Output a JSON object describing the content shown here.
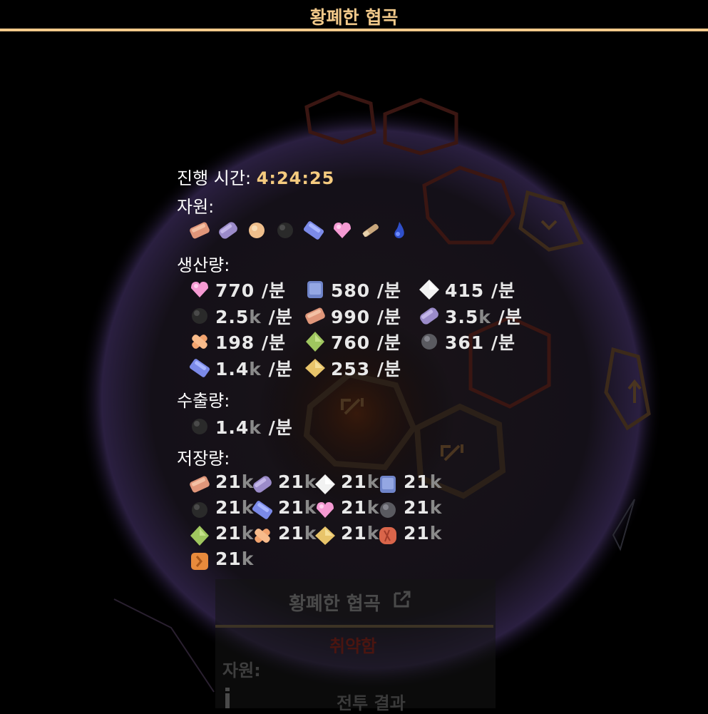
{
  "header": {
    "title": "황폐한 협곡"
  },
  "details": {
    "elapsed_label": "진행 시간:",
    "elapsed_value": "4:24:25",
    "resources_label": "자원:",
    "resources": [
      "copper-ore",
      "mythril-ore",
      "sand",
      "coal",
      "cobalt-ore",
      "heart-crystal",
      "wood",
      "water"
    ],
    "production_label": "생산량:",
    "production": [
      {
        "icon": "pink-heart",
        "amount": "770",
        "unit": " /분"
      },
      {
        "icon": "blue-block",
        "amount": "580",
        "unit": " /분"
      },
      {
        "icon": "white-diamond",
        "amount": "415",
        "unit": " /분"
      },
      {
        "icon": "coal",
        "amount": "2.5",
        "suffix": "k",
        "unit": " /분"
      },
      {
        "icon": "copper-ore",
        "amount": "990",
        "unit": " /분"
      },
      {
        "icon": "mythril-ore",
        "amount": "3.5",
        "suffix": "k",
        "unit": " /분"
      },
      {
        "icon": "orange-stripes",
        "amount": "198",
        "unit": " /분"
      },
      {
        "icon": "green-diamond",
        "amount": "760",
        "unit": " /분"
      },
      {
        "icon": "grey-stone",
        "amount": "361",
        "unit": " /분"
      },
      {
        "icon": "cobalt-ore",
        "amount": "1.4",
        "suffix": "k",
        "unit": " /분"
      },
      {
        "icon": "gold-diamond",
        "amount": "253",
        "unit": " /분"
      }
    ],
    "export_label": "수출량:",
    "export": [
      {
        "icon": "coal",
        "amount": "1.4",
        "suffix": "k",
        "unit": " /분"
      }
    ],
    "storage_label": "저장량:",
    "storage": [
      {
        "icon": "copper-ore",
        "amount": "21",
        "suffix": "k"
      },
      {
        "icon": "mythril-ore",
        "amount": "21",
        "suffix": "k"
      },
      {
        "icon": "white-diamond",
        "amount": "21",
        "suffix": "k"
      },
      {
        "icon": "blue-block",
        "amount": "21",
        "suffix": "k"
      },
      {
        "icon": "coal",
        "amount": "21",
        "suffix": "k"
      },
      {
        "icon": "cobalt-ore",
        "amount": "21",
        "suffix": "k"
      },
      {
        "icon": "pink-heart",
        "amount": "21",
        "suffix": "k"
      },
      {
        "icon": "grey-stone",
        "amount": "21",
        "suffix": "k"
      },
      {
        "icon": "green-diamond",
        "amount": "21",
        "suffix": "k"
      },
      {
        "icon": "orange-stripes",
        "amount": "21",
        "suffix": "k"
      },
      {
        "icon": "gold-diamond",
        "amount": "21",
        "suffix": "k"
      },
      {
        "icon": "red-ore",
        "amount": "21",
        "suffix": "k"
      },
      {
        "icon": "orange-ore",
        "amount": "21",
        "suffix": "k"
      }
    ]
  },
  "underlying_panel": {
    "title": "황폐한 협곡",
    "subtitle": "취약함",
    "resources_label": "자원:",
    "battle_label": "전투 결과"
  },
  "colors": {
    "accent": "#f2c98a",
    "time": "#f5cb7f",
    "background": "#000000"
  }
}
